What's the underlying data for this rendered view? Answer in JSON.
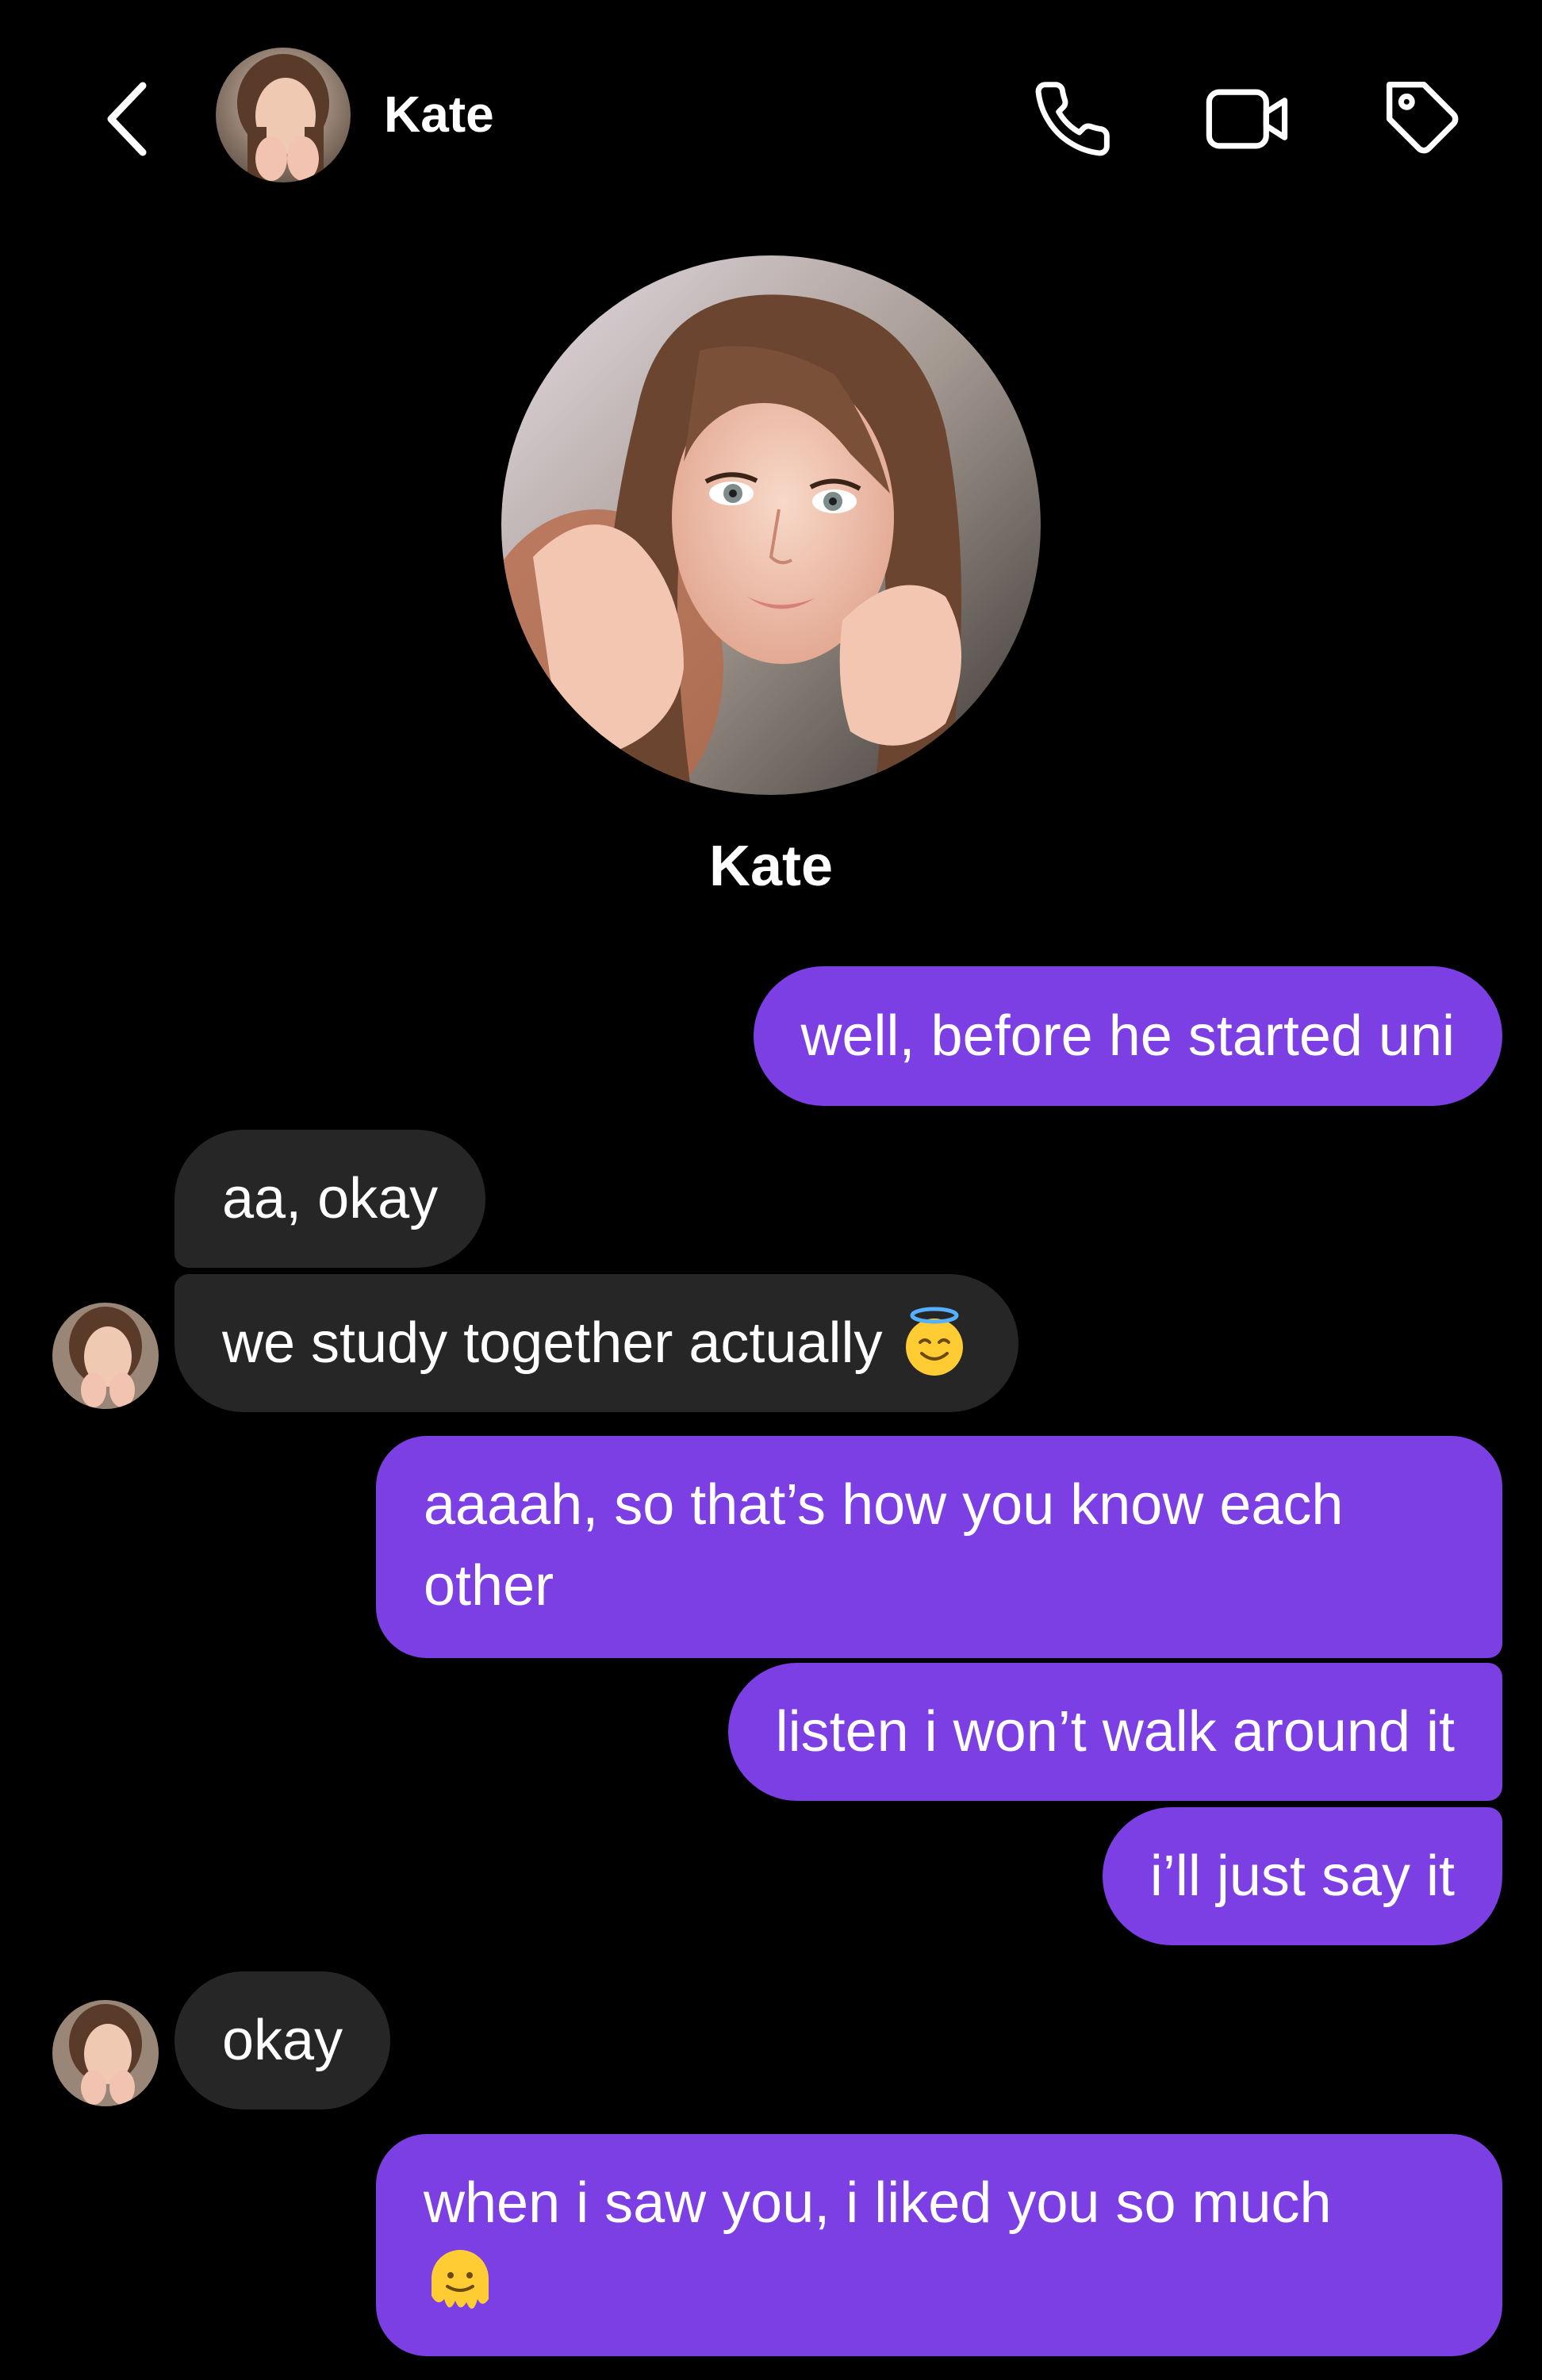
{
  "header": {
    "contact_name": "Kate",
    "icons": {
      "back": "chevron-left-icon",
      "call": "phone-icon",
      "video": "video-camera-icon",
      "tag": "tag-icon"
    }
  },
  "profile": {
    "name": "Kate"
  },
  "colors": {
    "background": "#000000",
    "sent_bubble": "#7b3fe4",
    "received_bubble": "#262626",
    "text": "#ffffff"
  },
  "messages": [
    {
      "sender": "me",
      "text": "well, before he started uni"
    },
    {
      "sender": "Kate",
      "text": "aa, okay"
    },
    {
      "sender": "Kate",
      "text": "we study together actually",
      "emoji": "smiling-face-with-halo"
    },
    {
      "sender": "me",
      "text": "aaaah, so that’s how you know each other"
    },
    {
      "sender": "me",
      "text": "listen i won’t walk around it"
    },
    {
      "sender": "me",
      "text": "i’ll just say it"
    },
    {
      "sender": "Kate",
      "text": "okay"
    },
    {
      "sender": "me",
      "text": "when i saw you, i liked you so much",
      "emoji": "melting-face"
    }
  ]
}
